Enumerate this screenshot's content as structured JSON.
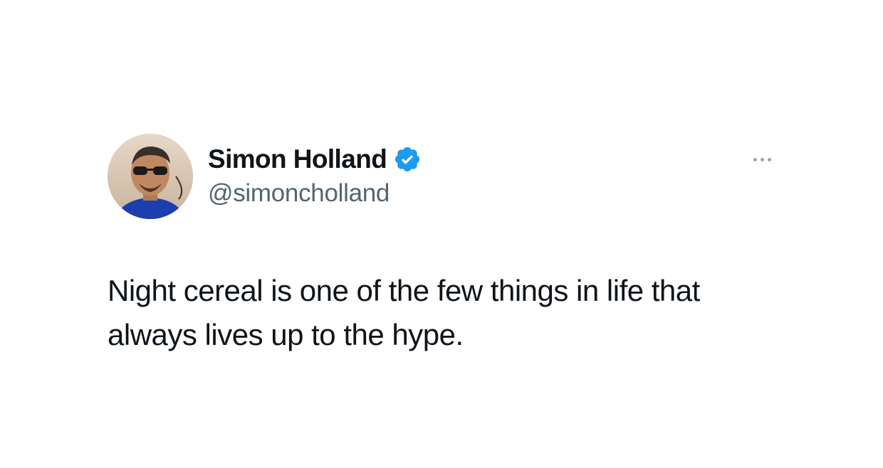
{
  "tweet": {
    "author": {
      "display_name": "Simon Holland",
      "handle": "@simoncholland",
      "verified": true,
      "verified_badge_color": "#1d9bf0",
      "avatar_icon": "profile-photo"
    },
    "more_icon": "ellipsis-icon",
    "text": "Night cereal is one of the few things in life that\nalways lives up to the hype."
  },
  "colors": {
    "name": "#0f1419",
    "handle": "#536471",
    "background": "#ffffff"
  }
}
